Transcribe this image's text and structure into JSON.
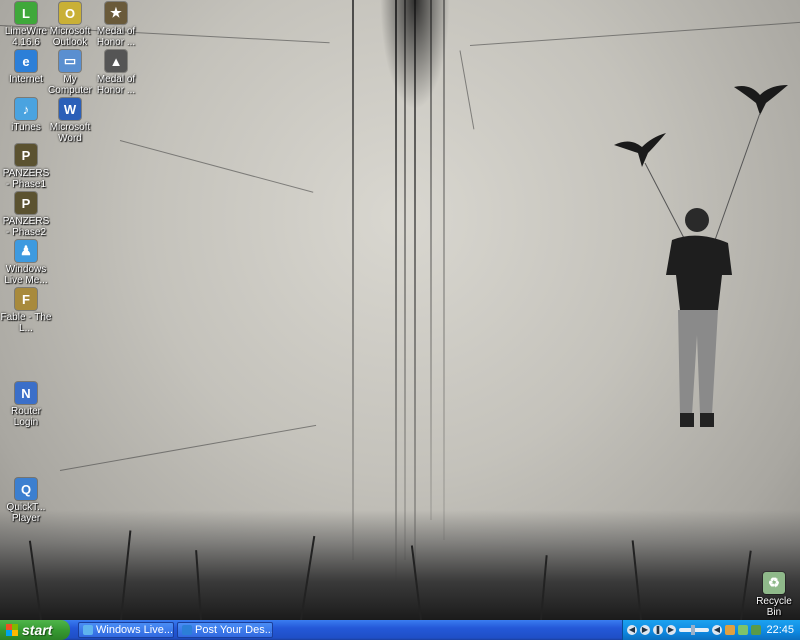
{
  "desktop": {
    "icons": [
      {
        "label": "LimeWire 4.16.6",
        "icon": "limewire-icon",
        "color": "#3fa83a",
        "glyph": "L"
      },
      {
        "label": "Microsoft Outlook",
        "icon": "outlook-icon",
        "color": "#c9b036",
        "glyph": "O"
      },
      {
        "label": "Medal of Honor ...",
        "icon": "medal-of-honor-icon",
        "color": "#6a5a3a",
        "glyph": "★"
      },
      {
        "label": "Internet",
        "icon": "internet-explorer-icon",
        "color": "#2c7fd8",
        "glyph": "e"
      },
      {
        "label": "My Computer",
        "icon": "my-computer-icon",
        "color": "#5a8fd0",
        "glyph": "▭"
      },
      {
        "label": "Medal of Honor ...",
        "icon": "medal-of-honor-icon",
        "color": "#555",
        "glyph": "▲"
      },
      {
        "label": "iTunes",
        "icon": "itunes-icon",
        "color": "#4aa3e0",
        "glyph": "♪"
      },
      {
        "label": "Microsoft Word",
        "icon": "word-icon",
        "color": "#2b5fb8",
        "glyph": "W"
      },
      {
        "label": "PANZERS - Phase1",
        "icon": "panzers-icon",
        "color": "#5b5230",
        "glyph": "P"
      },
      {
        "label": "PANZERS - Phase2",
        "icon": "panzers-icon",
        "color": "#5b5230",
        "glyph": "P"
      },
      {
        "label": "Windows Live Me...",
        "icon": "windows-live-messenger-icon",
        "color": "#3d9ae0",
        "glyph": "♟"
      },
      {
        "label": "Fable - The L...",
        "icon": "fable-icon",
        "color": "#a88a3c",
        "glyph": "F"
      },
      {
        "label": "Router Login",
        "icon": "router-login-icon",
        "color": "#3b6fc9",
        "glyph": "N"
      },
      {
        "label": "QuickT... Player",
        "icon": "quicktime-icon",
        "color": "#3c7fd0",
        "glyph": "Q"
      },
      {
        "label": "Recycle Bin",
        "icon": "recycle-bin-icon",
        "color": "#8fb98a",
        "glyph": "♻"
      }
    ]
  },
  "taskbar": {
    "start_label": "start",
    "tasks": [
      {
        "label": "Windows Live...",
        "icon": "windows-live-messenger-icon"
      },
      {
        "label": "Post Your Des...",
        "icon": "internet-explorer-icon"
      }
    ],
    "clock": "22:45"
  }
}
